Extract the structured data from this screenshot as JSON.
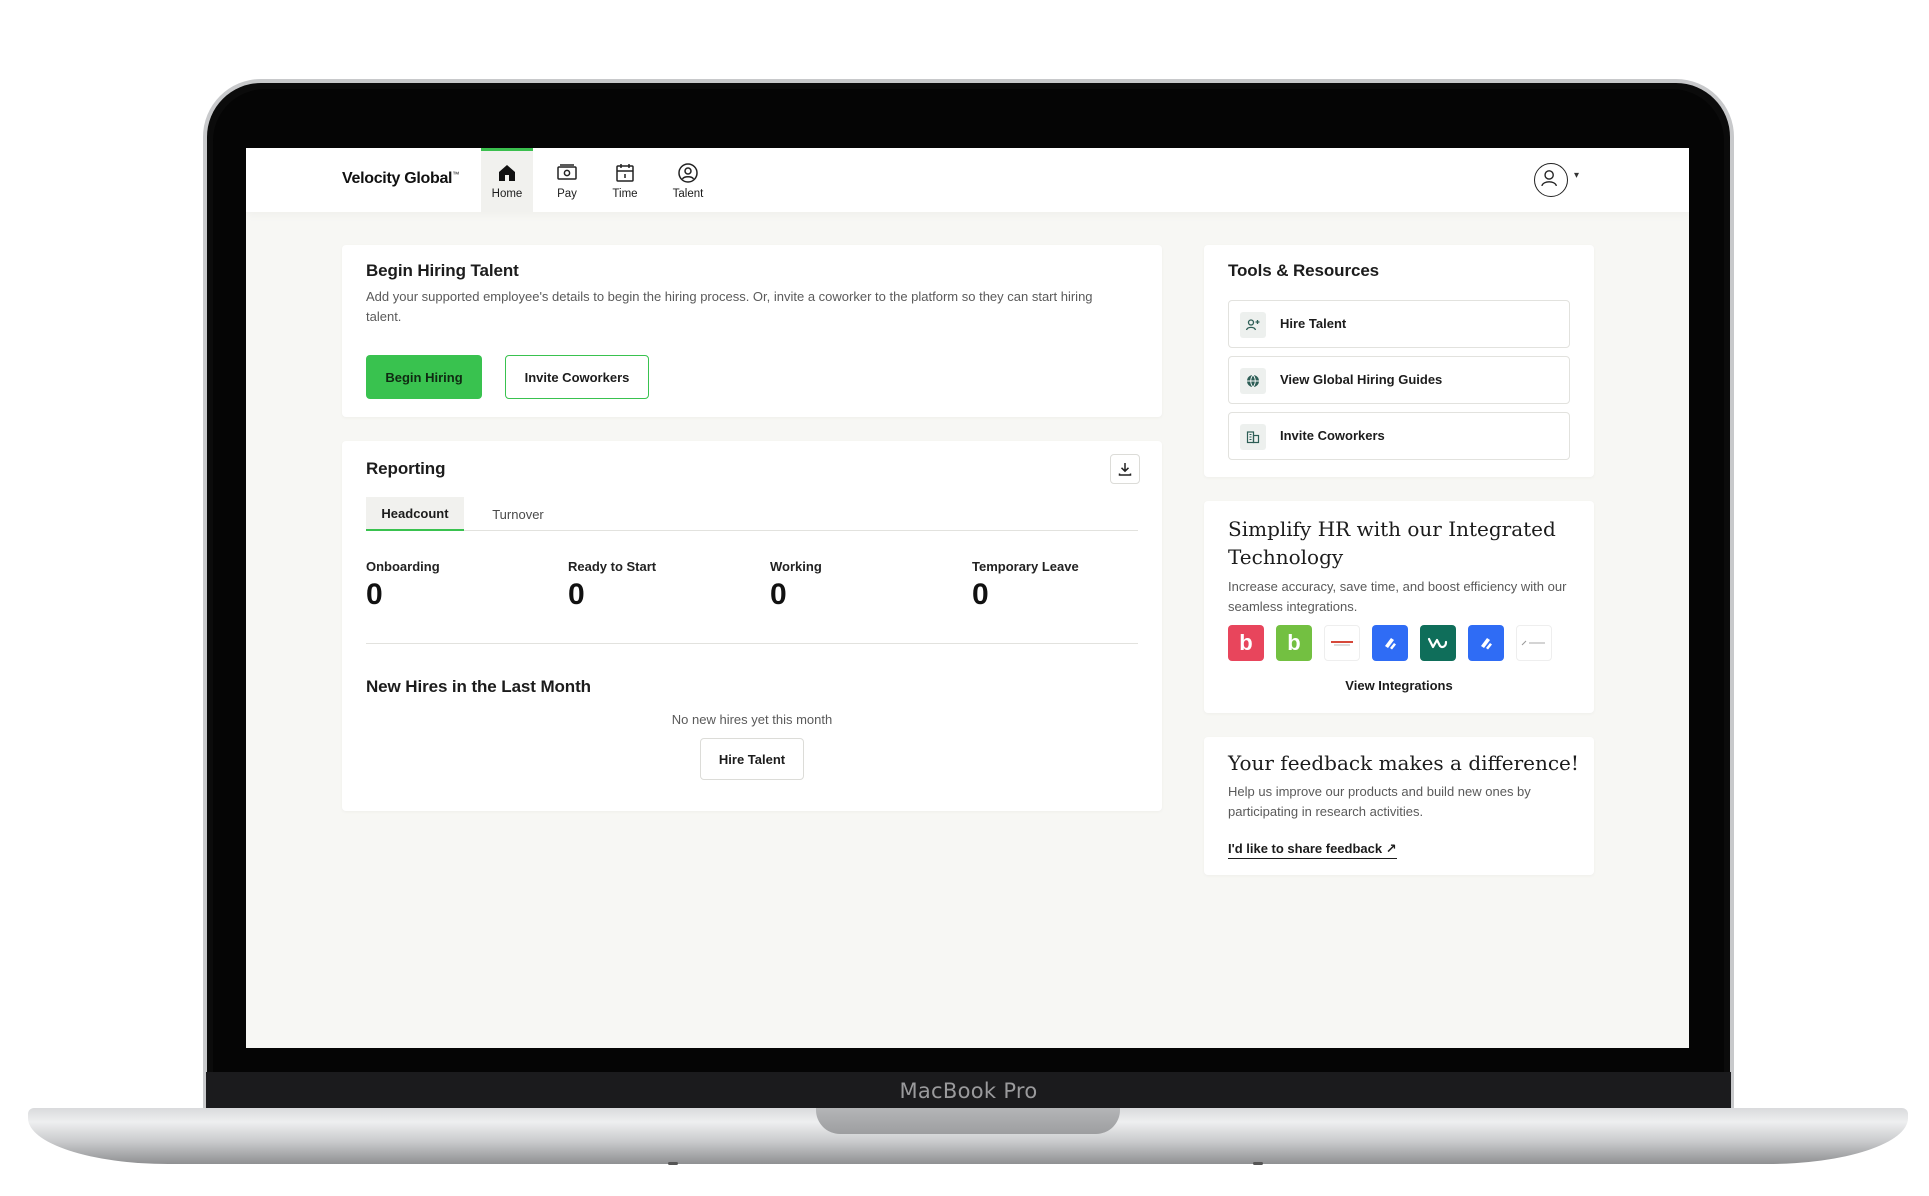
{
  "device": {
    "label": "MacBook Pro"
  },
  "nav": {
    "brand": "Velocity Global",
    "items": [
      {
        "label": "Home",
        "icon": "home-icon",
        "active": true
      },
      {
        "label": "Pay",
        "icon": "money-icon"
      },
      {
        "label": "Time",
        "icon": "calendar-icon"
      },
      {
        "label": "Talent",
        "icon": "person-icon"
      }
    ],
    "profile_icon": "avatar-icon"
  },
  "hiring": {
    "title": "Begin Hiring Talent",
    "description": "Add your supported employee's details to begin the hiring process. Or, invite a coworker to the platform so they can start hiring talent.",
    "primary_button": "Begin Hiring",
    "secondary_button": "Invite Coworkers"
  },
  "reporting": {
    "title": "Reporting",
    "tabs": [
      {
        "label": "Headcount",
        "active": true
      },
      {
        "label": "Turnover"
      }
    ],
    "stats": [
      {
        "label": "Onboarding",
        "value": "0"
      },
      {
        "label": "Ready to Start",
        "value": "0"
      },
      {
        "label": "Working",
        "value": "0"
      },
      {
        "label": "Temporary Leave",
        "value": "0"
      }
    ],
    "new_hires_title": "New Hires in the Last Month",
    "empty_message": "No new hires yet this month",
    "hire_button": "Hire Talent"
  },
  "tools": {
    "title": "Tools & Resources",
    "items": [
      {
        "label": "Hire Talent",
        "icon": "add-person-icon"
      },
      {
        "label": "View Global Hiring Guides",
        "icon": "globe-icon"
      },
      {
        "label": "Invite Coworkers",
        "icon": "building-icon"
      }
    ]
  },
  "integrations": {
    "title_line1": "Simplify HR with our Integrated",
    "title_line2": "Technology",
    "description": "Increase accuracy, save time, and boost efficiency with our seamless integrations.",
    "logos": [
      {
        "name": "bamboohr-b-icon",
        "color": "#e8455c"
      },
      {
        "name": "bamboo-leaf-icon",
        "color": "#73c041"
      },
      {
        "name": "oracle-icon",
        "color": "#ffffff"
      },
      {
        "name": "jira-blue-icon",
        "color": "#2f6cf5"
      },
      {
        "name": "workable-w-icon",
        "color": "#0f6e5a"
      },
      {
        "name": "jira-blue-icon-2",
        "color": "#2f6cf5"
      },
      {
        "name": "lever-icon",
        "color": "#ffffff"
      }
    ],
    "link": "View Integrations"
  },
  "feedback": {
    "title": "Your feedback makes a difference!",
    "description": "Help us improve our products and build new ones by participating in research activities.",
    "link": "I'd like to share feedback ↗"
  }
}
